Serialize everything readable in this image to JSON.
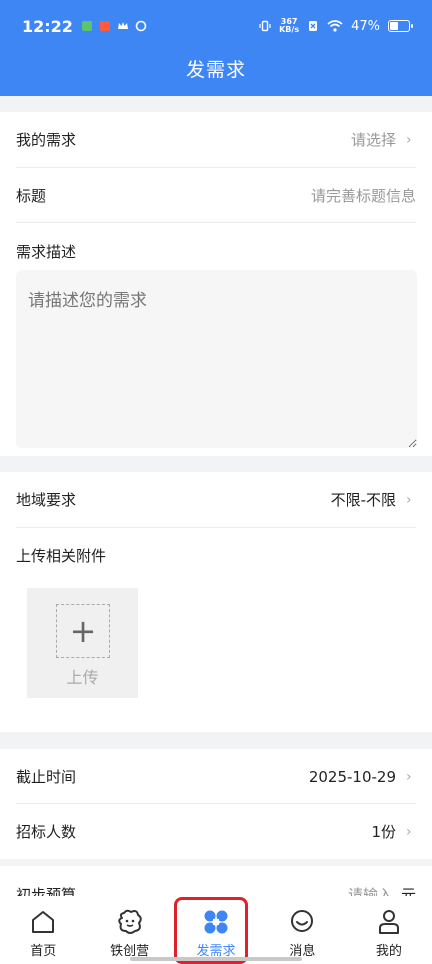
{
  "status_bar": {
    "time": "12:22",
    "net_speed_value": "367",
    "net_speed_unit": "KB/s",
    "battery_percent": "47%",
    "battery_level": 0.47
  },
  "page_title": "发需求",
  "section1": {
    "my_demand_label": "我的需求",
    "my_demand_value": "请选择",
    "title_label": "标题",
    "title_placeholder": "请完善标题信息",
    "desc_label": "需求描述",
    "desc_placeholder": "请描述您的需求"
  },
  "section2": {
    "region_label": "地域要求",
    "region_value": "不限-不限",
    "attachment_label": "上传相关附件",
    "upload_plus": "+",
    "upload_label": "上传"
  },
  "section3": {
    "deadline_label": "截止时间",
    "deadline_value": "2025-10-29",
    "bidders_label": "招标人数",
    "bidders_value": "1份"
  },
  "section4": {
    "budget_label": "初步预算",
    "budget_placeholder": "请输入",
    "budget_unit": "元"
  },
  "chevron": "›",
  "tabbar": {
    "home": "首页",
    "tiechuangying": "铁创营",
    "post_demand": "发需求",
    "messages": "消息",
    "mine": "我的"
  },
  "colors": {
    "primary": "#3f86f5",
    "highlight": "#e0202a"
  }
}
